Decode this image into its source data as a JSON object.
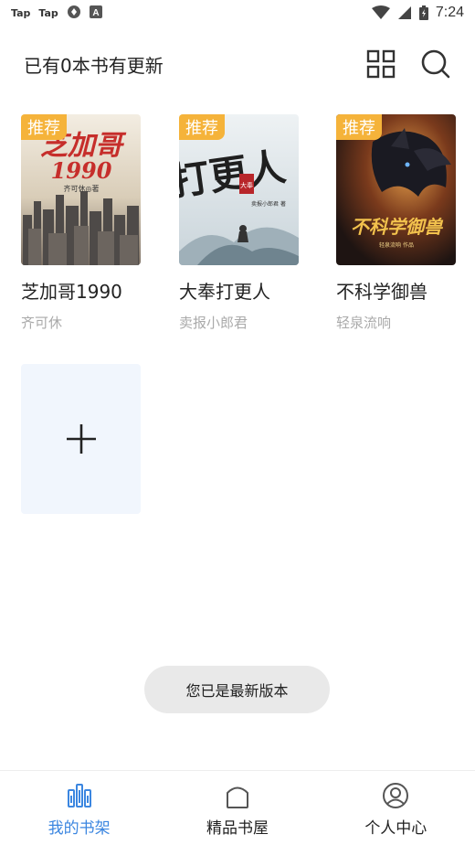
{
  "status_bar": {
    "app_icon_1": "Tap",
    "app_icon_2": "Tap",
    "time": "7:24",
    "icons": [
      "taptap-icon",
      "taptap-icon",
      "sync-icon",
      "a-icon",
      "wifi-icon",
      "signal-icon",
      "battery-icon"
    ]
  },
  "header": {
    "title": "已有0本书有更新",
    "actions": [
      "grid-view-icon",
      "search-icon"
    ]
  },
  "books": [
    {
      "badge": "推荐",
      "title": "芝加哥1990",
      "author": "齐可休",
      "cover_text": "芝加哥",
      "cover_number": "1990",
      "cover_byline": "齐可休◎著",
      "cover_color": "#8a7a6a"
    },
    {
      "badge": "推荐",
      "title": "大奉打更人",
      "author": "卖报小郎君",
      "cover_text": "打更人",
      "cover_seal": "大奉",
      "cover_byline": "卖报小郎君 著",
      "cover_color": "#dfe7ec"
    },
    {
      "badge": "推荐",
      "title": "不科学御兽",
      "author": "轻泉流响",
      "cover_text": "不科学御兽",
      "cover_byline": "轻泉流响 作品",
      "cover_color": "#3a2a22"
    }
  ],
  "add_book": {
    "icon": "plus-icon"
  },
  "toast": {
    "text": "您已是最新版本"
  },
  "bottom_nav": [
    {
      "label": "我的书架",
      "icon": "bookshelf-icon",
      "active": true
    },
    {
      "label": "精品书屋",
      "icon": "house-icon",
      "active": false
    },
    {
      "label": "个人中心",
      "icon": "profile-icon",
      "active": false
    }
  ],
  "colors": {
    "accent": "#3b86e0",
    "badge": "#f5b33a",
    "add_tile": "#f1f6fd"
  }
}
